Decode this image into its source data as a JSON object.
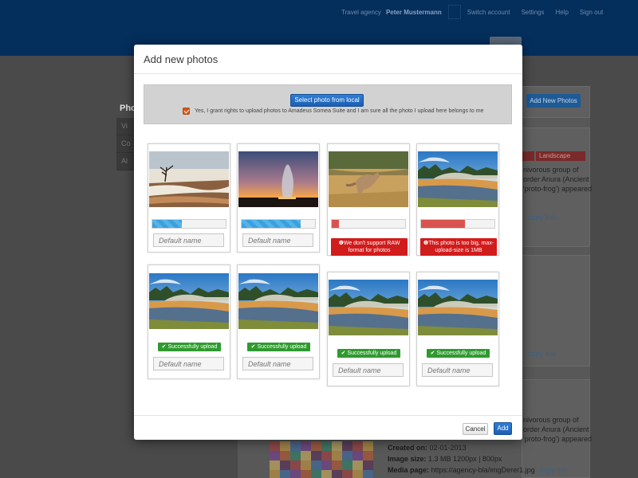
{
  "topbar": {
    "agency_label": "Travel agency",
    "user_name": "Peter Mustermann",
    "links": [
      "Switch account",
      "Settings",
      "Help",
      "Sign out"
    ]
  },
  "background": {
    "sidebar_title": "Pho",
    "sidebar_items": [
      "Vi",
      "Co",
      "Al"
    ],
    "add_new_photos_label": "Add New Photos",
    "tag_label": "Landscape",
    "desc_block_1": [
      "nivorous group of",
      "order Anura (Ancient",
      "'proto-frog') appeared"
    ],
    "copy_link_label": "copy link",
    "desc_block_2": [
      "nivorous group of",
      "order Anura (Ancient",
      "'proto-frog') appeared"
    ],
    "created_on_label": "Created on:",
    "created_on_value": "02-01-2013",
    "image_size_label": "Image size:",
    "image_size_value": "1.3 MB 1200px | 800px",
    "media_page_label": "Media page:",
    "media_page_value": "https://agency-bla/imgDerer1.jpg"
  },
  "modal": {
    "title": "Add new photos",
    "select_button": "Select photo from local",
    "rights_text": "Yes, I grant rights to upload photos to Amadeus Somea Suite and I am sure all the photo I upload here belongs to me",
    "rights_checked": true,
    "cancel_button": "Cancel",
    "add_button": "Add"
  },
  "photos": [
    {
      "scene": "terraces",
      "status": "uploading",
      "progress": 0.4,
      "name_placeholder": "Default name"
    },
    {
      "scene": "geyser-sunset",
      "status": "uploading",
      "progress": 0.8,
      "name_placeholder": "Default name"
    },
    {
      "scene": "coyote",
      "status": "error",
      "progress": 0.1,
      "message": "❶We don't support RAW format for photos"
    },
    {
      "scene": "river",
      "status": "error",
      "progress": 0.6,
      "message": "❶This photo is too big, max-upload-size is 1MB"
    },
    {
      "scene": "river",
      "status": "success",
      "message": "Successfully upload",
      "name_placeholder": "Default name"
    },
    {
      "scene": "river",
      "status": "success",
      "message": "Successfully upload",
      "name_placeholder": "Default name"
    },
    {
      "scene": "river",
      "status": "success",
      "message": "Successfully upload",
      "name_placeholder": "Default name"
    },
    {
      "scene": "river",
      "status": "success",
      "message": "Successfully upload",
      "name_placeholder": "Default name"
    }
  ],
  "colors": {
    "primary_blue": "#1b5fb2",
    "error_red": "#d11c1c",
    "success_green": "#2f9a2f",
    "topbar_navy": "#042e5c"
  }
}
